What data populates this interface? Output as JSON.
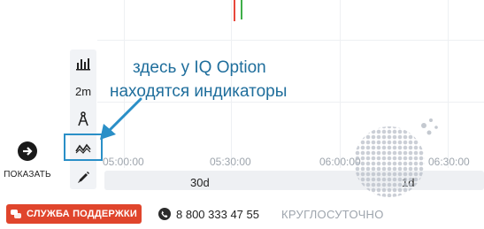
{
  "annotation": {
    "line1": "здесь у IQ Option",
    "line2": "находятся индикаторы"
  },
  "toolbar": {
    "timeframe_label": "2m",
    "icons": [
      "chart-type-icon",
      "compass-icon",
      "indicators-icon",
      "pencil-icon"
    ]
  },
  "show_button": {
    "label": "ПОКАЗАТЬ"
  },
  "time_axis": {
    "labels": [
      "05:00:00",
      "05:30:00",
      "06:00:00",
      "06:30:00"
    ]
  },
  "period_bar": {
    "left_label": "30d",
    "right_label": "1d"
  },
  "footer": {
    "support_label": "СЛУЖБА ПОДДЕРЖКИ",
    "phone": "8 800 333 47 55",
    "hours": "КРУГЛОСУТОЧНО"
  },
  "colors": {
    "accent": "#2a8fc7",
    "annotation_text": "#1f6e9c",
    "support_red": "#e0452c",
    "candle_red": "#e8473c",
    "candle_green": "#3fae49"
  }
}
